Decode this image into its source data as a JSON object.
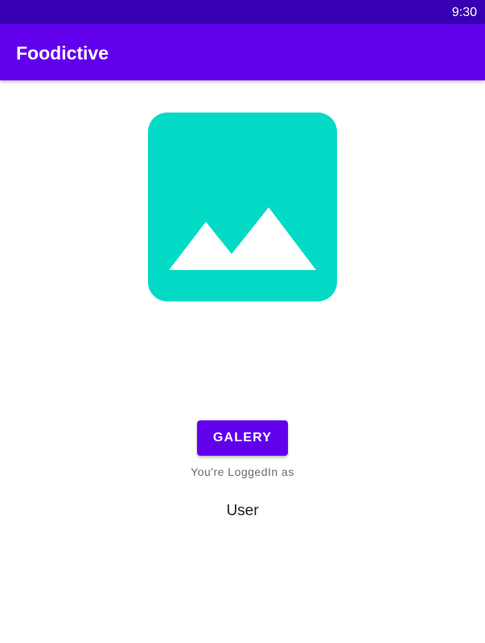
{
  "status_bar": {
    "time": "9:30"
  },
  "app_bar": {
    "title": "Foodictive"
  },
  "main": {
    "image_icon": "image-placeholder-icon",
    "gallery_button_label": "GALERY",
    "logged_in_label": "You're LoggedIn as",
    "username": "User"
  },
  "colors": {
    "status_bar": "#3700b3",
    "app_bar": "#6200ee",
    "image_background": "#03dac5",
    "button": "#6200ee"
  }
}
